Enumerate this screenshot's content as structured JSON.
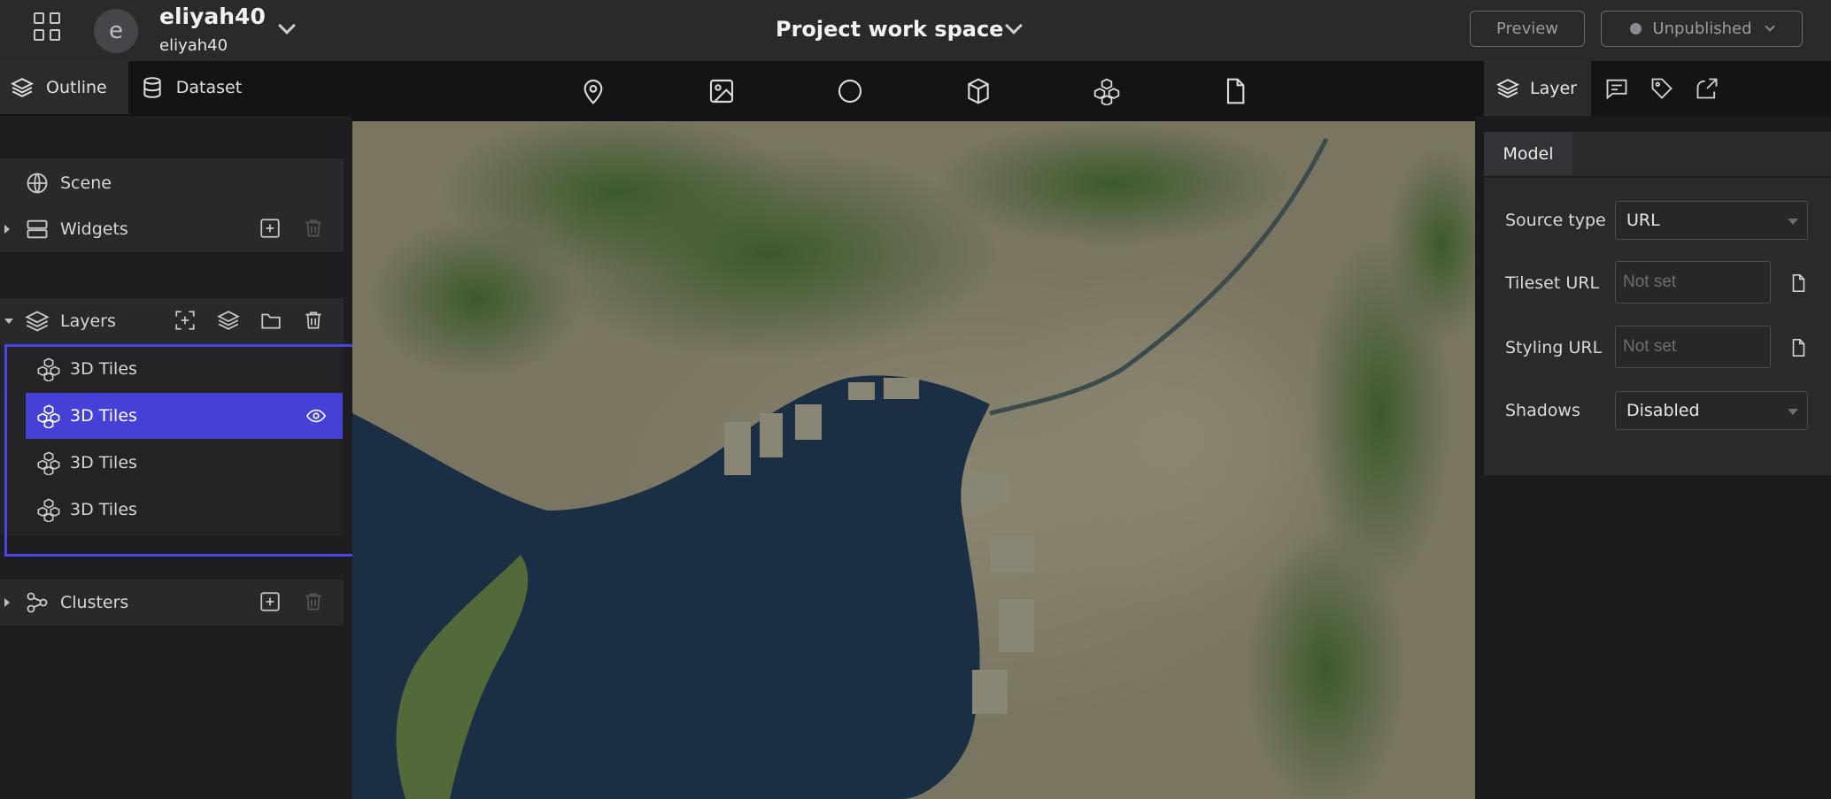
{
  "header": {
    "user_name": "eliyah40",
    "user_sub": "eliyah40",
    "avatar_letter": "e",
    "project_title": "Project work space",
    "preview_label": "Preview",
    "publish_status": "Unpublished"
  },
  "left_tabs": {
    "outline": "Outline",
    "dataset": "Dataset"
  },
  "outline": {
    "scene": "Scene",
    "widgets": "Widgets",
    "layers": "Layers",
    "layer_items": [
      "3D Tiles",
      "3D Tiles",
      "3D Tiles",
      "3D Tiles"
    ],
    "selected_index": 1,
    "clusters": "Clusters"
  },
  "toolbar_icons": [
    "map-pin-icon",
    "image-icon",
    "circle-icon",
    "box-icon",
    "cubes-icon",
    "file-icon"
  ],
  "right_tabs": {
    "layer": "Layer"
  },
  "model": {
    "tab": "Model",
    "source_type_label": "Source type",
    "source_type_value": "URL",
    "tileset_url_label": "Tileset URL",
    "tileset_url_placeholder": "Not set",
    "styling_url_label": "Styling URL",
    "styling_url_placeholder": "Not set",
    "shadows_label": "Shadows",
    "shadows_value": "Disabled"
  },
  "colors": {
    "accent": "#4540d6",
    "highlight_border": "#4a44e6",
    "background": "#1b1b1d"
  }
}
